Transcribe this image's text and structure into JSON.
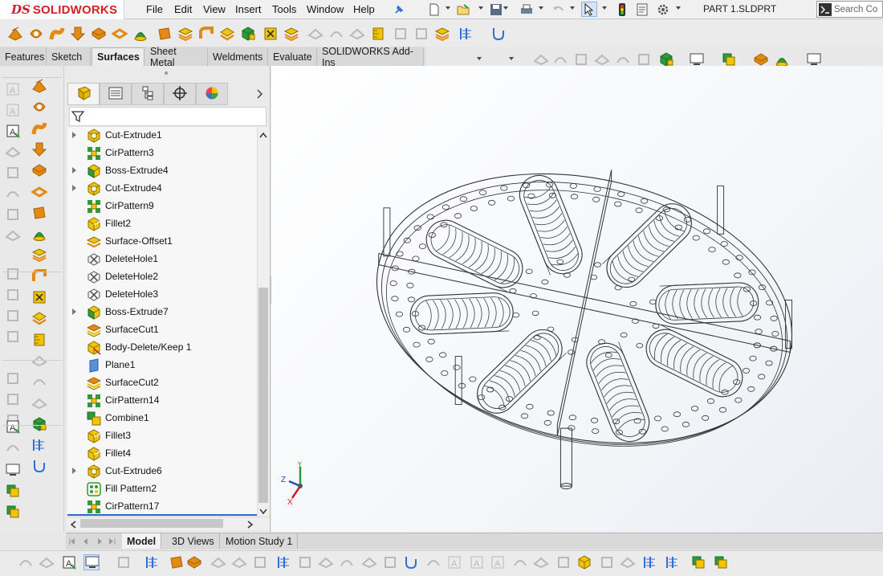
{
  "app": {
    "logo_prefix": "DS",
    "logo_name": "SOLIDWORKS",
    "document_title": "PART 1.SLDPRT"
  },
  "menu": [
    "File",
    "Edit",
    "View",
    "Insert",
    "Tools",
    "Window",
    "Help"
  ],
  "search": {
    "placeholder": "Search Co"
  },
  "command_tabs": [
    {
      "label": "Features",
      "active": false
    },
    {
      "label": "Sketch",
      "active": false
    },
    {
      "label": "Surfaces",
      "active": true
    },
    {
      "label": "Sheet Metal",
      "active": false
    },
    {
      "label": "Weldments",
      "active": false
    },
    {
      "label": "Evaluate",
      "active": false
    },
    {
      "label": "SOLIDWORKS Add-Ins",
      "active": false
    }
  ],
  "feature_tree": [
    {
      "label": "Cut-Extrude1",
      "expandable": true,
      "icon": "cut-extrude-icon"
    },
    {
      "label": "CirPattern3",
      "expandable": false,
      "icon": "circular-pattern-icon"
    },
    {
      "label": "Boss-Extrude4",
      "expandable": true,
      "icon": "boss-extrude-icon"
    },
    {
      "label": "Cut-Extrude4",
      "expandable": true,
      "icon": "cut-extrude-icon"
    },
    {
      "label": "CirPattern9",
      "expandable": false,
      "icon": "circular-pattern-icon"
    },
    {
      "label": "Fillet2",
      "expandable": false,
      "icon": "fillet-icon"
    },
    {
      "label": "Surface-Offset1",
      "expandable": false,
      "icon": "surface-offset-icon"
    },
    {
      "label": "DeleteHole1",
      "expandable": false,
      "icon": "delete-hole-icon"
    },
    {
      "label": "DeleteHole2",
      "expandable": false,
      "icon": "delete-hole-icon"
    },
    {
      "label": "DeleteHole3",
      "expandable": false,
      "icon": "delete-hole-icon"
    },
    {
      "label": "Boss-Extrude7",
      "expandable": true,
      "icon": "boss-extrude-icon"
    },
    {
      "label": "SurfaceCut1",
      "expandable": false,
      "icon": "surface-cut-icon"
    },
    {
      "label": "Body-Delete/Keep 1",
      "expandable": false,
      "icon": "body-delete-icon"
    },
    {
      "label": "Plane1",
      "expandable": false,
      "icon": "plane-icon"
    },
    {
      "label": "SurfaceCut2",
      "expandable": false,
      "icon": "surface-cut-icon"
    },
    {
      "label": "CirPattern14",
      "expandable": false,
      "icon": "circular-pattern-icon"
    },
    {
      "label": "Combine1",
      "expandable": false,
      "icon": "combine-icon"
    },
    {
      "label": "Fillet3",
      "expandable": false,
      "icon": "fillet-icon"
    },
    {
      "label": "Fillet4",
      "expandable": false,
      "icon": "fillet-icon"
    },
    {
      "label": "Cut-Extrude6",
      "expandable": true,
      "icon": "cut-extrude-icon"
    },
    {
      "label": "Fill Pattern2",
      "expandable": false,
      "icon": "fill-pattern-icon"
    },
    {
      "label": "CirPattern17",
      "expandable": false,
      "icon": "circular-pattern-icon"
    }
  ],
  "bottom_tabs": [
    {
      "label": "Model",
      "active": true
    },
    {
      "label": "3D Views",
      "active": false
    },
    {
      "label": "Motion Study 1",
      "active": false
    }
  ],
  "triad": {
    "x": "X",
    "y": "Y",
    "z": "Z"
  },
  "colors": {
    "brand": "#d32027",
    "feature_yellow": "#f2c500",
    "pattern_green": "#2f9a3a",
    "cmd_orange": "#e38a12"
  }
}
